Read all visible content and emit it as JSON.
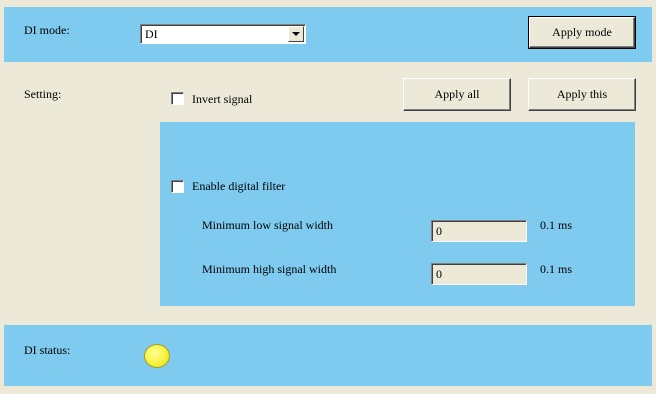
{
  "mode": {
    "label": "DI mode:",
    "selected": "DI",
    "apply_label": "Apply mode"
  },
  "setting": {
    "label": "Setting:",
    "invert_label": "Invert signal",
    "invert_checked": false,
    "apply_all_label": "Apply all",
    "apply_this_label": "Apply this"
  },
  "filter": {
    "enable_label": "Enable digital filter",
    "enable_checked": false,
    "low": {
      "label": "Minimum low signal width",
      "value": "0",
      "unit": "0.1 ms"
    },
    "high": {
      "label": "Minimum high signal width",
      "value": "0",
      "unit": "0.1 ms"
    }
  },
  "status": {
    "label": "DI status:",
    "led_color": "#f6f23a"
  }
}
